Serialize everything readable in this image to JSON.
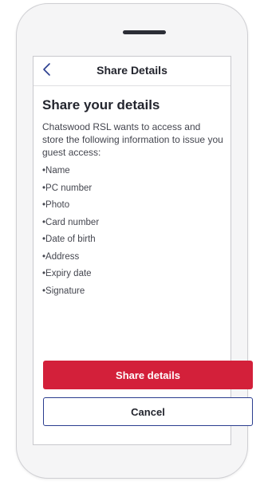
{
  "nav": {
    "title": "Share Details",
    "back_icon": "chevron-left-icon",
    "accent_color": "#2a3d8f"
  },
  "content": {
    "heading": "Share your details",
    "intro": "Chatswood RSL wants to access and store the following information to issue you guest access:",
    "items": [
      "Name",
      "PC number",
      "Photo",
      "Card number",
      "Date of birth",
      "Address",
      "Expiry date",
      "Signature"
    ]
  },
  "actions": {
    "share_label": "Share details",
    "share_color": "#d3203a",
    "cancel_label": "Cancel"
  }
}
